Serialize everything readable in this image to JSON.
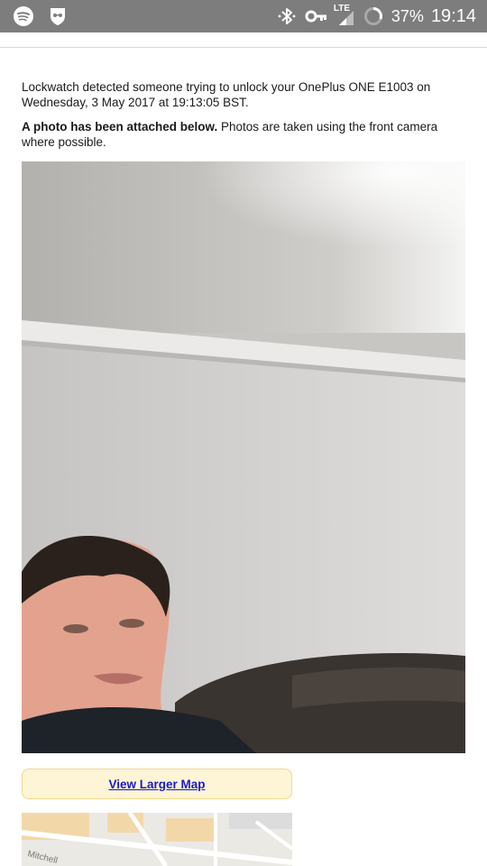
{
  "status_bar": {
    "battery_percent": "37%",
    "time": "19:14",
    "network": "LTE",
    "left_icons": [
      "spotify-icon",
      "incognito-icon"
    ],
    "right_icons": [
      "bluetooth-icon",
      "vpn-key-icon",
      "signal-icon",
      "battery-ring-icon"
    ]
  },
  "email": {
    "intro": "Lockwatch detected someone trying to unlock your OnePlus ONE E1003 on Wednesday, 3 May 2017 at 19:13:05 BST.",
    "photo_note_bold": "A photo has been attached below.",
    "photo_note_rest": " Photos are taken using the front camera where possible."
  },
  "map": {
    "link_label": "View Larger Map",
    "street_label": "Mitchell"
  }
}
